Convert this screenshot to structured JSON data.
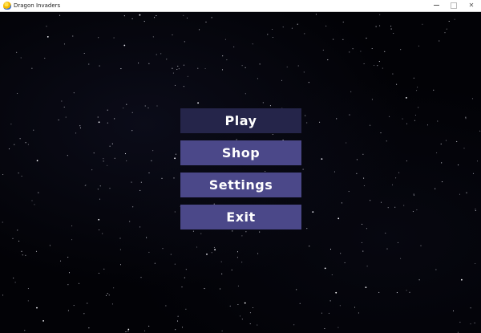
{
  "window": {
    "title": "Dragon Invaders",
    "icon": "python-snake-icon",
    "controls": {
      "minimize": "minimize-icon",
      "maximize": "maximize-icon",
      "close": "close-icon"
    }
  },
  "menu": {
    "items": [
      {
        "label": "Play",
        "selected": true
      },
      {
        "label": "Shop",
        "selected": false
      },
      {
        "label": "Settings",
        "selected": false
      },
      {
        "label": "Exit",
        "selected": false
      }
    ]
  },
  "colors": {
    "background": "#020206",
    "button": "#4b4889",
    "button_selected": "#25254a",
    "text": "#ffffff"
  }
}
